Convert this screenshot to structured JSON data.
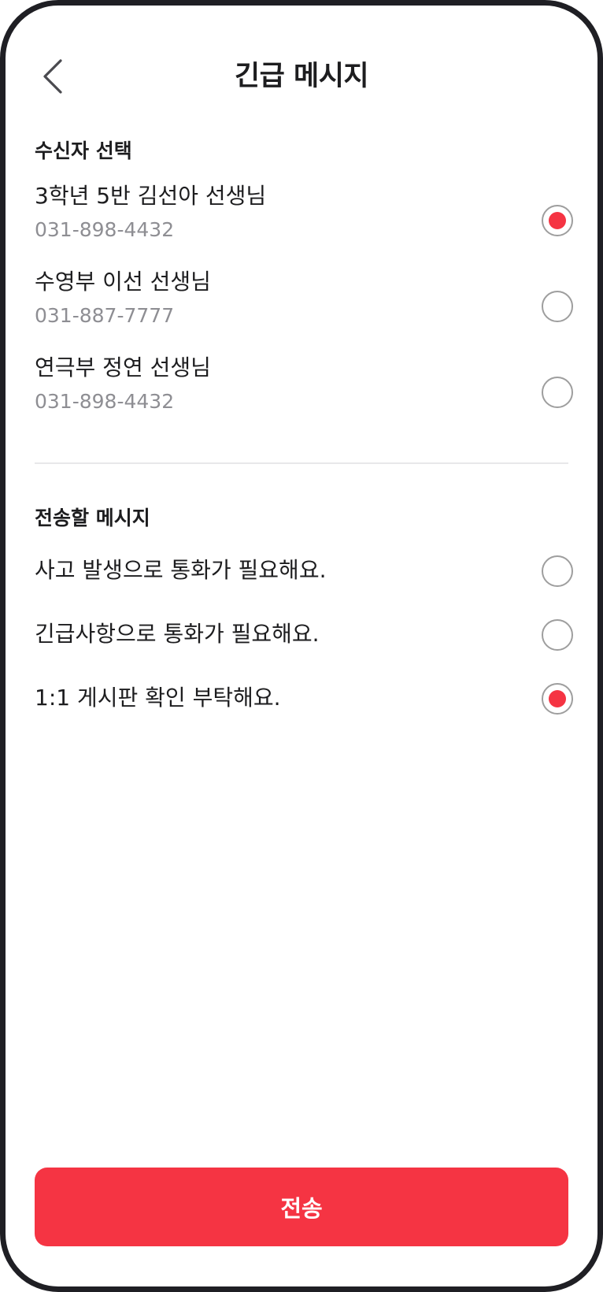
{
  "header": {
    "title": "긴급 메시지",
    "back_icon": "chevron-left-icon"
  },
  "recipients_section": {
    "title": "수신자 선택",
    "items": [
      {
        "name": "3학년 5반 김선아 선생님",
        "phone": "031-898-4432",
        "selected": true
      },
      {
        "name": "수영부 이선 선생님",
        "phone": "031-887-7777",
        "selected": false
      },
      {
        "name": "연극부 정연 선생님",
        "phone": "031-898-4432",
        "selected": false
      }
    ]
  },
  "messages_section": {
    "title": "전송할 메시지",
    "items": [
      {
        "text": "사고 발생으로 통화가 필요해요.",
        "selected": false
      },
      {
        "text": "긴급사항으로 통화가 필요해요.",
        "selected": false
      },
      {
        "text": "1:1 게시판 확인 부탁해요.",
        "selected": true
      }
    ]
  },
  "send_button": {
    "label": "전송"
  },
  "colors": {
    "accent": "#f53443",
    "text_primary": "#1d1d1f",
    "text_secondary": "#8e8e93",
    "frame": "#1f1f24"
  }
}
